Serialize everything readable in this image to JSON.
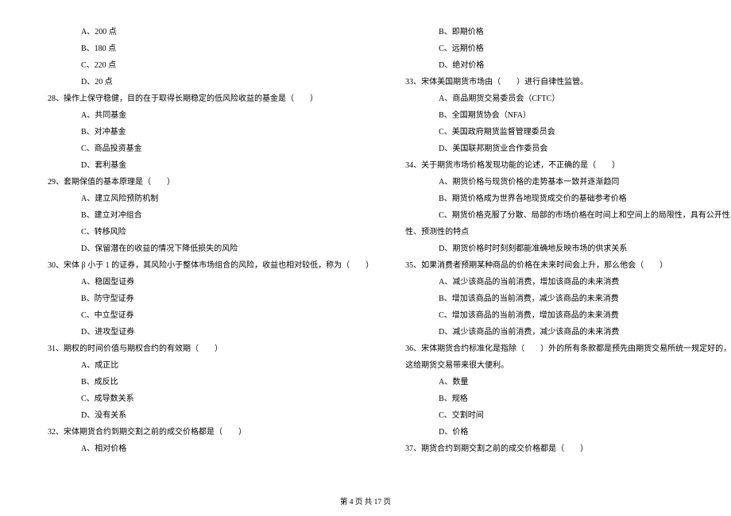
{
  "left_column": [
    {
      "type": "option",
      "text": "A、200 点"
    },
    {
      "type": "option",
      "text": "B、180 点"
    },
    {
      "type": "option",
      "text": "C、220 点"
    },
    {
      "type": "option",
      "text": "D、20 点"
    },
    {
      "type": "question",
      "text": "28、操作上保守稳健，目的在于取得长期稳定的低风险收益的基金是（　　）"
    },
    {
      "type": "option",
      "text": "A、共同基金"
    },
    {
      "type": "option",
      "text": "B、对冲基金"
    },
    {
      "type": "option",
      "text": "C、商品投资基金"
    },
    {
      "type": "option",
      "text": "D、套利基金"
    },
    {
      "type": "question",
      "text": "29、套期保值的基本原理是（　　）"
    },
    {
      "type": "option",
      "text": "A、建立风险预防机制"
    },
    {
      "type": "option",
      "text": "B、建立对冲组合"
    },
    {
      "type": "option",
      "text": "C、转移风险"
    },
    {
      "type": "option",
      "text": "D、保留潜在的收益的情况下降低损失的风险"
    },
    {
      "type": "question",
      "text": "30、宋体 β 小于 1 的证券，其风险小于整体市场组合的风险，收益也相对较低，称为（　　）"
    },
    {
      "type": "option",
      "text": "A、稳固型证券"
    },
    {
      "type": "option",
      "text": "B、防守型证券"
    },
    {
      "type": "option",
      "text": "C、中立型证券"
    },
    {
      "type": "option",
      "text": "D、进攻型证券"
    },
    {
      "type": "question",
      "text": "31、期权的时间价值与期权合约的有效期（　　）"
    },
    {
      "type": "option",
      "text": "A、成正比"
    },
    {
      "type": "option",
      "text": "B、成反比"
    },
    {
      "type": "option",
      "text": "C、成导数关系"
    },
    {
      "type": "option",
      "text": "D、没有关系"
    },
    {
      "type": "question",
      "text": "32、宋体期货合约到期交割之前的成交价格都是（　　）"
    },
    {
      "type": "option",
      "text": "A、相对价格"
    }
  ],
  "right_column": [
    {
      "type": "option",
      "text": "B、即期价格"
    },
    {
      "type": "option",
      "text": "C、远期价格"
    },
    {
      "type": "option",
      "text": "D、绝对价格"
    },
    {
      "type": "question",
      "text": "33、宋体美国期货市场由（　　）进行自律性监管。"
    },
    {
      "type": "option",
      "text": "A、商品期货交易委员会（CFTC）"
    },
    {
      "type": "option",
      "text": "B、全国期货协会（NFA）"
    },
    {
      "type": "option",
      "text": "C、美国政府期货监督管理委员会"
    },
    {
      "type": "option",
      "text": "D、美国联邦期货业合作委员会"
    },
    {
      "type": "question",
      "text": "34、关于期货市场价格发现功能的论述，不正确的是（　　）"
    },
    {
      "type": "option",
      "text": "A、期货价格与现货价格的走势基本一致并逐渐趋同"
    },
    {
      "type": "option",
      "text": "B、期货价格成为世界各地现货成交价的基础参考价格"
    },
    {
      "type": "option",
      "text": "C、期货价格克服了分散、局部的市场价格在时间上和空间上的局限性，具有公开性、连续"
    },
    {
      "type": "continuation",
      "text": "性、预测性的特点"
    },
    {
      "type": "option",
      "text": "D、期货价格时时刻刻都能准确地反映市场的供求关系"
    },
    {
      "type": "question",
      "text": "35、如果消费者预期某种商品的价格在未来时间会上升，那么他会（　　）"
    },
    {
      "type": "option",
      "text": "A、减少该商品的当前消费，增加该商品的未来消费"
    },
    {
      "type": "option",
      "text": "B、增加该商品的当前消费，减少该商品的未来消费"
    },
    {
      "type": "option",
      "text": "C、增加该商品的当前消费，增加该商品的未来消费"
    },
    {
      "type": "option",
      "text": "D、减少该商品的当前消费，减少该商品的未来消费"
    },
    {
      "type": "question",
      "text": "36、宋体期货合约标准化是指除（　　）外的所有条款都是预先由期货交易所统一规定好的，"
    },
    {
      "type": "continuation",
      "text": "这给期货交易带来很大便利。"
    },
    {
      "type": "option",
      "text": "A、数量"
    },
    {
      "type": "option",
      "text": "B、规格"
    },
    {
      "type": "option",
      "text": "C、交割时间"
    },
    {
      "type": "option",
      "text": "D、价格"
    },
    {
      "type": "question",
      "text": "37、期货合约到期交割之前的成交价格都是（　　）"
    }
  ],
  "footer": "第 4 页 共 17 页"
}
